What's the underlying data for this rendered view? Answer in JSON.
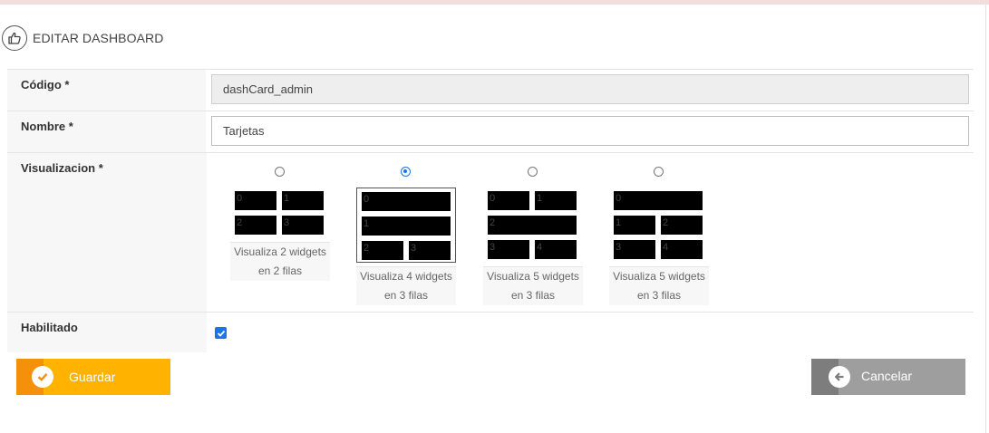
{
  "header": {
    "title": "EDITAR DASHBOARD",
    "icon": "thumbs-up-icon"
  },
  "form": {
    "codigo": {
      "label": "Código *",
      "value": "dashCard_admin"
    },
    "nombre": {
      "label": "Nombre *",
      "value": "Tarjetas"
    },
    "visualizacion": {
      "label": "Visualizacion *",
      "selected_index": 1,
      "options": [
        {
          "rows": [
            [
              "0",
              "1"
            ],
            [
              "2",
              "3"
            ]
          ],
          "caption": [
            "Visualiza 2 widgets",
            "en 2 filas"
          ]
        },
        {
          "rows": [
            [
              "0"
            ],
            [
              "1"
            ],
            [
              "2",
              "3"
            ]
          ],
          "caption": [
            "Visualiza 4 widgets",
            "en 3 filas"
          ]
        },
        {
          "rows": [
            [
              "0",
              "1"
            ],
            [
              "2"
            ],
            [
              "3",
              "4"
            ]
          ],
          "caption": [
            "Visualiza 5 widgets",
            "en 3 filas"
          ]
        },
        {
          "rows": [
            [
              "0"
            ],
            [
              "1",
              "2"
            ],
            [
              "3",
              "4"
            ]
          ],
          "caption": [
            "Visualiza 5 widgets",
            "en 3 filas"
          ]
        }
      ]
    },
    "habilitado": {
      "label": "Habilitado",
      "checked": true
    }
  },
  "buttons": {
    "save": {
      "label": "Guardar",
      "icon": "check-icon",
      "color": "#ffb300"
    },
    "cancel": {
      "label": "Cancelar",
      "icon": "arrow-left-icon",
      "color": "#9e9e9e"
    }
  },
  "colors": {
    "accent": "#1a73e8",
    "top_bar": "#f3dede"
  }
}
